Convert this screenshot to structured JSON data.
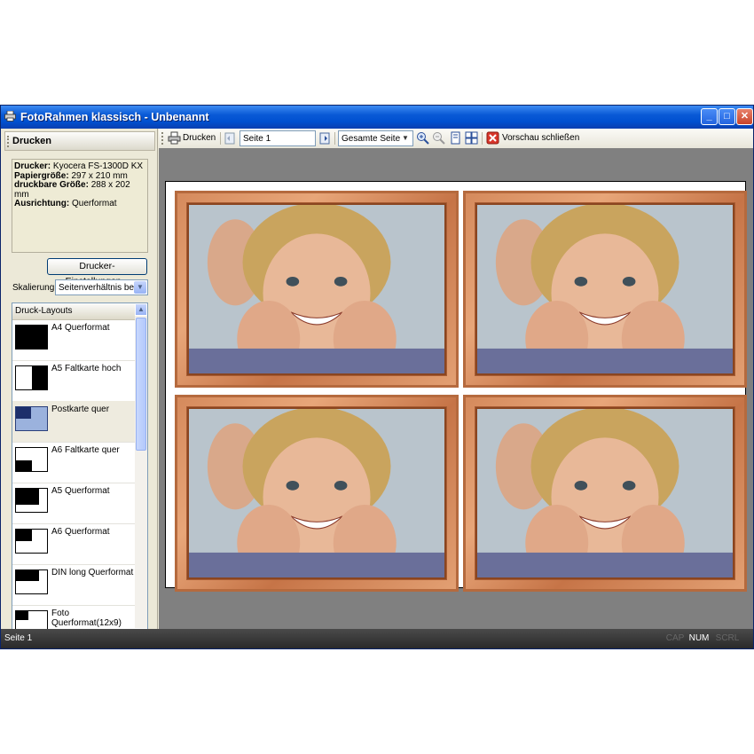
{
  "window": {
    "title": "FotoRahmen klassisch - Unbenannt"
  },
  "left_panel": {
    "header": "Drucken",
    "info": [
      {
        "key": "Drucker:",
        "value": "Kyocera FS-1300D KX"
      },
      {
        "key": "Papiergröße:",
        "value": "297 x 210 mm"
      },
      {
        "key": "druckbare Größe:",
        "value": "288 x 202 mm"
      },
      {
        "key": "Ausrichtung:",
        "value": "Querformat"
      }
    ],
    "printer_settings_button": "Drucker-Einstellungen...",
    "scaling_label": "Skalierung:",
    "scaling_value": "Seitenverhältnis beibehalten",
    "layouts_header": "Druck-Layouts",
    "layouts": [
      {
        "label": "A4 Querformat"
      },
      {
        "label": "A5 Faltkarte hoch"
      },
      {
        "label": "Postkarte quer",
        "selected": true
      },
      {
        "label": "A6 Faltkarte quer"
      },
      {
        "label": "A5 Querformat"
      },
      {
        "label": "A6 Querformat"
      },
      {
        "label": "DIN long Querformat"
      },
      {
        "label": "Foto Querformat(12x9)"
      }
    ]
  },
  "toolbar": {
    "print_label": "Drucken",
    "page_value": "Seite 1",
    "zoom_value": "Gesamte Seite",
    "close_preview_label": "Vorschau schließen"
  },
  "status": {
    "left": "Seite 1",
    "cap": "CAP",
    "num": "NUM",
    "scrl": "SCRL"
  },
  "colors": {
    "title_bar": "#0a5ad6",
    "frame": "#d58a5c",
    "preview_bg": "#808080"
  }
}
